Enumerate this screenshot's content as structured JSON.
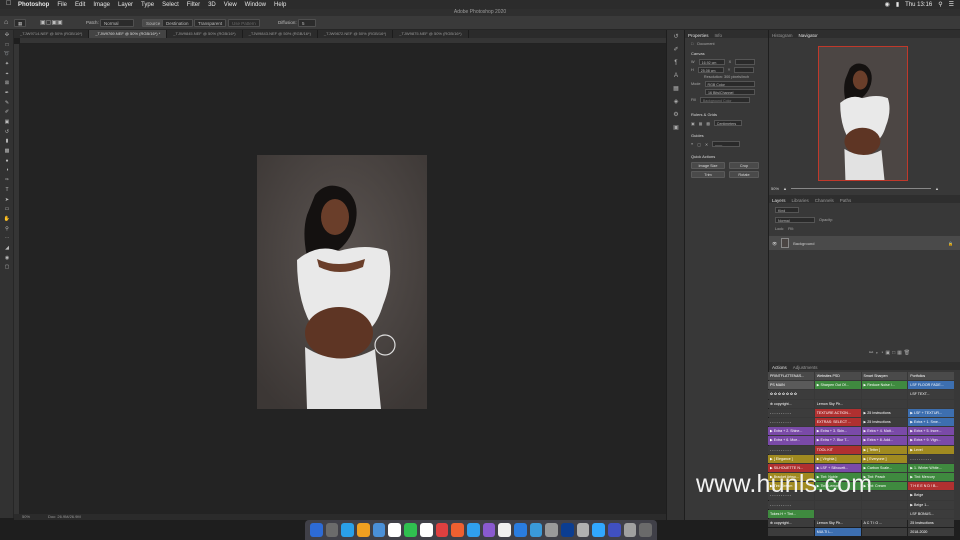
{
  "menubar": {
    "app": "Photoshop",
    "items": [
      "File",
      "Edit",
      "Image",
      "Layer",
      "Type",
      "Select",
      "Filter",
      "3D",
      "View",
      "Window",
      "Help"
    ],
    "clock": "Thu 13:16"
  },
  "app_title": "Adobe Photoshop 2020",
  "options_bar": {
    "patch_label": "Patch:",
    "patch_value": "Normal",
    "source": "Source",
    "destination": "Destination",
    "transparent": "Transparent",
    "use_pattern": "Use Pattern",
    "diffusion_label": "Diffusion:",
    "diffusion_value": "5"
  },
  "tabs": [
    "_TJW9714.NEF @ 50% (RGB/16*)",
    "_TJW9769.NEF @ 50% (RGB/16*) *",
    "_TJW9845.NEF @ 50% (RGB/16*)",
    "_TJW9843.NEF @ 50% (RGB/16*)",
    "_TJW9872.NEF @ 50% (RGB/16*)",
    "_TJW9875.NEF @ 50% (RGB/16*)"
  ],
  "status": {
    "zoom": "50%",
    "doc": "Doc: 26.9M/26.9M"
  },
  "properties": {
    "tabs": [
      "Properties",
      "Info"
    ],
    "doc_label": "Document",
    "canvas_title": "Canvas",
    "w": "16.92 cm",
    "h": "25.08 cm",
    "x": "",
    "y": "",
    "resolution": "Resolution: 300 pixels/inch",
    "mode_label": "Mode",
    "mode_value": "RGB Color",
    "bits_value": "16 Bits/Channel",
    "fill_label": "Fill",
    "fill_value": "Background Color",
    "rulers_title": "Rulers & Grids",
    "units": "Centimeters",
    "guides_title": "Guides",
    "quick_title": "Quick Actions",
    "btn_image_size": "Image Size",
    "btn_crop": "Crop",
    "btn_trim": "Trim",
    "btn_rotate": "Rotate"
  },
  "navigator": {
    "tabs": [
      "Histogram",
      "Navigator"
    ],
    "zoom": "50%"
  },
  "layers": {
    "tabs": [
      "Layers",
      "Libraries",
      "Channels",
      "Paths"
    ],
    "kind": "Kind",
    "normal": "Normal",
    "opacity": "Opacity:",
    "lock": "Lock:",
    "fill": "Fill:",
    "layer_name": "Background"
  },
  "actions": {
    "tabs": [
      "Actions",
      "Adjustments"
    ],
    "cells": [
      {
        "t": "PRINTFLATTEN&S...",
        "c": "#4a4a4a"
      },
      {
        "t": "Websites PSD",
        "c": "#4a4a4a"
      },
      {
        "t": "Smart Sharpen",
        "c": "#4a4a4a"
      },
      {
        "t": "Portfolios",
        "c": "#4a4a4a"
      },
      {
        "t": "PS MAIN",
        "c": "#5a5a5a"
      },
      {
        "t": "▶ Sharpen Out Of...",
        "c": "#3f8a3f"
      },
      {
        "t": "▶ Reduce Noise /...",
        "c": "#3f8a3f"
      },
      {
        "t": "LSF FLOOR FADE...",
        "c": "#3d6fb0"
      },
      {
        "t": "✿ ✿ ✿ ✿ ✿ ✿ ✿",
        "c": "#3c3c3c"
      },
      {
        "t": "",
        "c": "#3c3c3c"
      },
      {
        "t": "",
        "c": "#3c3c3c"
      },
      {
        "t": "LSF TEXT...",
        "c": "#3c3c3c"
      },
      {
        "t": "⊕ copyright...",
        "c": "#3c3c3c"
      },
      {
        "t": "Lemon Sky Ph...",
        "c": "#3c3c3c"
      },
      {
        "t": "",
        "c": "#3c3c3c"
      },
      {
        "t": "",
        "c": "#3c3c3c"
      },
      {
        "t": "- - - - - - - - - -",
        "c": "#3c3c3c"
      },
      {
        "t": "TEXTURE ACTION...",
        "c": "#b03030"
      },
      {
        "t": "▶ 25 Instructions",
        "c": "#3c3c3c"
      },
      {
        "t": "▶ LSF + TEXTUR...",
        "c": "#3d6fb0"
      },
      {
        "t": "- - - - - - - - - -",
        "c": "#3c3c3c"
      },
      {
        "t": "EXTRAS: SELECT ...",
        "c": "#b03030"
      },
      {
        "t": "▶ 25 Instructions",
        "c": "#3c3c3c"
      },
      {
        "t": "▶ Extra + 1. Sme...",
        "c": "#3d6fb0"
      },
      {
        "t": "▶ Extra + 2. Shine...",
        "c": "#7a4aa8"
      },
      {
        "t": "▶ Extra + 3. Skin...",
        "c": "#7a4aa8"
      },
      {
        "t": "▶ Extra + 4. Matt...",
        "c": "#7a4aa8"
      },
      {
        "t": "▶ Extra + 5. Incre...",
        "c": "#7a4aa8"
      },
      {
        "t": "▶ Extra + 6. Moe...",
        "c": "#7a4aa8"
      },
      {
        "t": "▶ Extra + 7. Blur T...",
        "c": "#7a4aa8"
      },
      {
        "t": "▶ Extra + 8. Add...",
        "c": "#7a4aa8"
      },
      {
        "t": "▶ Extra + 9. Vign...",
        "c": "#7a4aa8"
      },
      {
        "t": "- - - - - - - - - -",
        "c": "#3c3c3c"
      },
      {
        "t": "TOOL KIT",
        "c": "#b03030"
      },
      {
        "t": "▶ [ Tetter ]",
        "c": "#a08a20"
      },
      {
        "t": "▶ Level",
        "c": "#a08a20"
      },
      {
        "t": "▶ [ Elegance ]",
        "c": "#a08a20"
      },
      {
        "t": "▶ [ Virginia ]",
        "c": "#a08a20"
      },
      {
        "t": "▶ [ Everyone ]",
        "c": "#a08a20"
      },
      {
        "t": "- - - - - - - - - -",
        "c": "#3c3c3c"
      },
      {
        "t": "▶ SILHOUETTE N...",
        "c": "#b03030"
      },
      {
        "t": "▶ LSF + Silhouett...",
        "c": "#7a4aa8"
      },
      {
        "t": "▶ Carbon Scale...",
        "c": "#3f8a3f"
      },
      {
        "t": "▶ 1. Winter White...",
        "c": "#3f8a3f"
      },
      {
        "t": "▶ Bracket Artwo...",
        "c": "#a08a20"
      },
      {
        "t": "▶ Tint: Noble",
        "c": "#3f8a3f"
      },
      {
        "t": "▶ Tint: Peach",
        "c": "#3f8a3f"
      },
      {
        "t": "▶ Tint: Mercury",
        "c": "#3f8a3f"
      },
      {
        "t": "▶ Tint: Dream",
        "c": "#a08a20"
      },
      {
        "t": "▶ Tint: Lemon",
        "c": "#3f8a3f"
      },
      {
        "t": "▶ Tint: Cream",
        "c": "#3f8a3f"
      },
      {
        "t": "T H E   E N D !  B...",
        "c": "#b03030"
      },
      {
        "t": "- - - - - - - - - -",
        "c": "#3c3c3c"
      },
      {
        "t": "",
        "c": "#3c3c3c"
      },
      {
        "t": "",
        "c": "#3c3c3c"
      },
      {
        "t": "▶ Beige",
        "c": "#3c3c3c"
      },
      {
        "t": "- - - - - - - - - -",
        "c": "#3c3c3c"
      },
      {
        "t": "",
        "c": "#3c3c3c"
      },
      {
        "t": "",
        "c": "#3c3c3c"
      },
      {
        "t": "▶ Beige 1...",
        "c": "#3c3c3c"
      },
      {
        "t": "Tokes H + Tint...",
        "c": "#3f8a3f"
      },
      {
        "t": "",
        "c": "#3c3c3c"
      },
      {
        "t": "",
        "c": "#3c3c3c"
      },
      {
        "t": "LSF BONUS...",
        "c": "#3c3c3c"
      },
      {
        "t": "⊕ copyright...",
        "c": "#3c3c3c"
      },
      {
        "t": "Lemon Sky Ph...",
        "c": "#3c3c3c"
      },
      {
        "t": "A C T I O ...",
        "c": "#3c3c3c"
      },
      {
        "t": "25 Instructions",
        "c": "#3c3c3c"
      },
      {
        "t": "",
        "c": "#3c3c3c"
      },
      {
        "t": "MULTI L...",
        "c": "#3d6fb0"
      },
      {
        "t": "",
        "c": "#3c3c3c"
      },
      {
        "t": "2018-2020",
        "c": "#3c3c3c"
      }
    ]
  },
  "watermark": "www.hunls.com",
  "dock_colors": [
    "#2d6bd6",
    "#6b6b6b",
    "#2aa0e8",
    "#f0a020",
    "#4a90d9",
    "#ffffff",
    "#30c050",
    "#ffffff",
    "#e04040",
    "#f06030",
    "#30a0f0",
    "#8a5ad0",
    "#f0f0f0",
    "#2a7de1",
    "#3a9ad9",
    "#9a9a9a",
    "#0b3d91",
    "#b0b0b0",
    "#31a8ff",
    "#4050c0",
    "#a0a0a0",
    "#6a6a6a"
  ],
  "dock_names": [
    "finder-icon",
    "launchpad-icon",
    "safari-icon",
    "notes-icon",
    "mail-icon",
    "calendar-icon",
    "facetime-icon",
    "photos-icon",
    "music-icon",
    "books-icon",
    "app-store-icon",
    "podcasts-icon",
    "reminders-icon",
    "system-prefs-icon",
    "finder2-icon",
    "trash-icon",
    "lightroom-icon",
    "preview-icon",
    "photoshop-icon",
    "bridge-icon",
    "downloads-icon",
    "trash-bin-icon"
  ]
}
